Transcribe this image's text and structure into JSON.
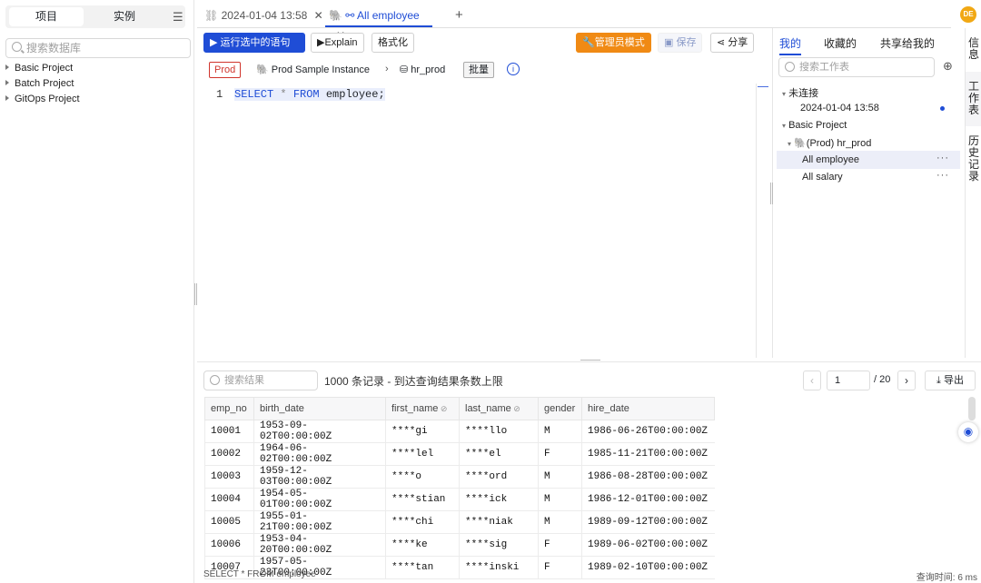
{
  "sidebar": {
    "tab_project": "项目",
    "tab_instance": "实例",
    "search_placeholder": "搜索数据库",
    "projects": [
      "Basic Project",
      "Batch Project",
      "GitOps Project"
    ]
  },
  "tabs": [
    {
      "label": "2024-01-04 13:58"
    },
    {
      "label": "All employee"
    }
  ],
  "toolbar": {
    "run": "运行选中的语句",
    "explain": "Explain",
    "format": "格式化",
    "admin": "管理员模式",
    "save": "保存",
    "share": "分享"
  },
  "context": {
    "env": "Prod",
    "instance": "Prod Sample Instance",
    "database": "hr_prod",
    "batch": "批量"
  },
  "editor": {
    "line_no": "1",
    "sql": {
      "k1": "SELECT",
      "star": " * ",
      "k2": "FROM",
      "rest": " employee;"
    }
  },
  "panel": {
    "tab_mine": "我的",
    "tab_fav": "收藏的",
    "tab_shared": "共享给我的",
    "search_placeholder": "搜索工作表",
    "unconnected": "未连接",
    "sheet_date": "2024-01-04 13:58",
    "project": "Basic Project",
    "db": "(Prod) hr_prod",
    "sheets": [
      "All employee",
      "All salary"
    ]
  },
  "side_tabs": [
    "信息",
    "工作表",
    "历史记录"
  ],
  "results": {
    "search_placeholder": "搜索结果",
    "summary": "1000 条记录 - 到达查询结果条数上限",
    "page": "1",
    "total": "/ 20",
    "export": "导出",
    "columns": [
      "emp_no",
      "birth_date",
      "first_name",
      "last_name",
      "gender",
      "hire_date"
    ],
    "rows": [
      [
        "10001",
        "1953-09-02T00:00:00Z",
        "****gi",
        "****llo",
        "M",
        "1986-06-26T00:00:00Z"
      ],
      [
        "10002",
        "1964-06-02T00:00:00Z",
        "****lel",
        "****el",
        "F",
        "1985-11-21T00:00:00Z"
      ],
      [
        "10003",
        "1959-12-03T00:00:00Z",
        "****o",
        "****ord",
        "M",
        "1986-08-28T00:00:00Z"
      ],
      [
        "10004",
        "1954-05-01T00:00:00Z",
        "****stian",
        "****ick",
        "M",
        "1986-12-01T00:00:00Z"
      ],
      [
        "10005",
        "1955-01-21T00:00:00Z",
        "****chi",
        "****niak",
        "M",
        "1989-09-12T00:00:00Z"
      ],
      [
        "10006",
        "1953-04-20T00:00:00Z",
        "****ke",
        "****sig",
        "F",
        "1989-06-02T00:00:00Z"
      ],
      [
        "10007",
        "1957-05-23T00:00:00Z",
        "****tan",
        "****inski",
        "F",
        "1989-02-10T00:00:00Z"
      ]
    ]
  },
  "status": {
    "query": "SELECT * FROM employee",
    "time": "查询时间: 6 ms"
  },
  "avatar": "DE"
}
